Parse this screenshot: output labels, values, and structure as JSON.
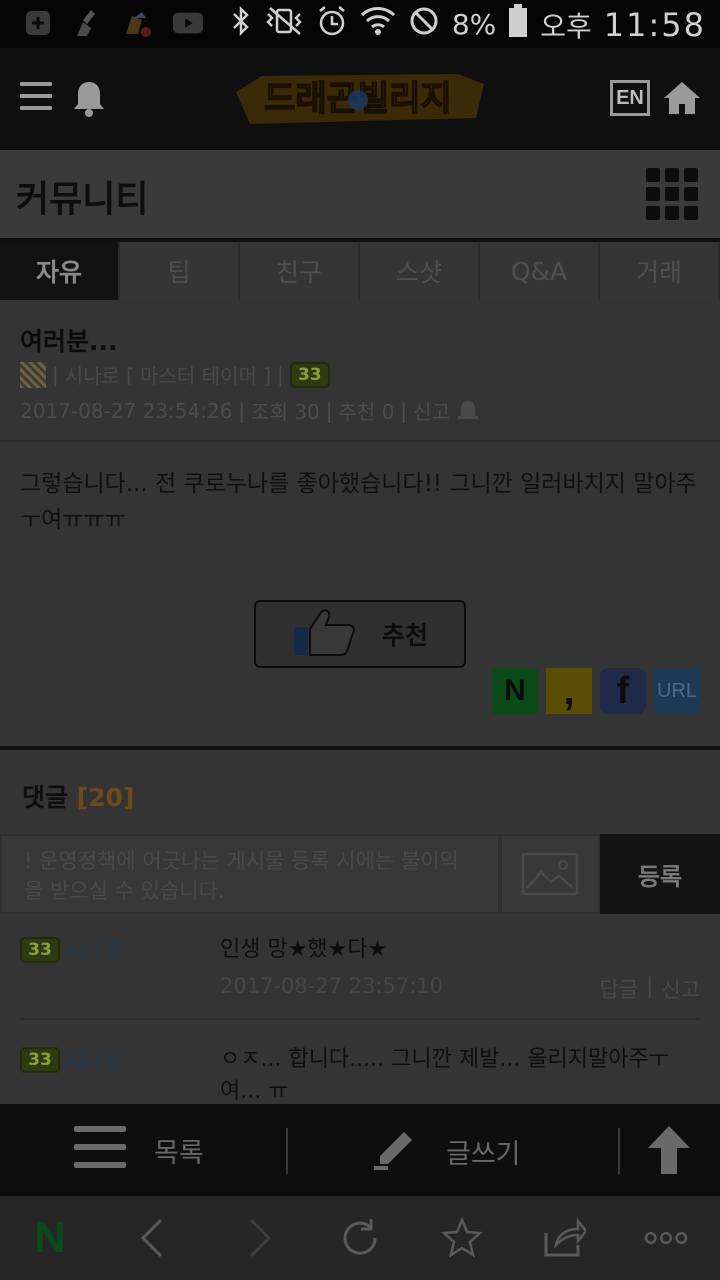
{
  "status_bar": {
    "battery": "8%",
    "ampm": "오후",
    "time": "11:58"
  },
  "header": {
    "logo_text": "드래곤빌리지",
    "lang_button": "EN"
  },
  "page_title": "커뮤니티",
  "tabs": [
    {
      "label": "자유",
      "active": true
    },
    {
      "label": "팁",
      "active": false
    },
    {
      "label": "친구",
      "active": false
    },
    {
      "label": "스샷",
      "active": false
    },
    {
      "label": "Q&A",
      "active": false
    },
    {
      "label": "거래",
      "active": false
    }
  ],
  "post": {
    "title": "여러분...",
    "author": "시나로",
    "author_title": "[ 마스터 테이머 ]",
    "level": "33",
    "date": "2017-08-27 23:54:26",
    "views": "조회 30",
    "recommends": "추천 0",
    "report": "신고",
    "body": "그렇습니다... 전 쿠로누나를 좋아했습니다!! 그니깐 일러바치지 말아주ㅜ여ㅠㅠㅠ",
    "like_label": "추천"
  },
  "share": {
    "naver": "N",
    "kakao": ",",
    "facebook": "f",
    "url": "URL"
  },
  "comments": {
    "title": "댓글",
    "count": "[20]",
    "placeholder": "! 운영정책에 어긋나는 게시물 등록 시에는 불이익을 받으실 수 있습니다.",
    "submit": "등록",
    "items": [
      {
        "level": "33",
        "author": "시나로",
        "text": "인생 망★했★다★",
        "date": "2017-08-27 23:57:10",
        "reply": "답글",
        "report": "신고"
      },
      {
        "level": "33",
        "author": "시나로",
        "text": "ㅇㅈ... 합니다..... 그니깐 제발... 올리지말아주ㅜ여... ㅠ"
      }
    ]
  },
  "action_bar": {
    "list": "목록",
    "write": "글쓰기"
  },
  "browser": {
    "naver_logo": "N"
  },
  "colors": {
    "dim_background": "#343434",
    "header_black": "#0f0f0f",
    "comment_count": "#6e4a1a",
    "naver_green": "#0a5a1c",
    "facebook_blue": "#1e2a48"
  }
}
